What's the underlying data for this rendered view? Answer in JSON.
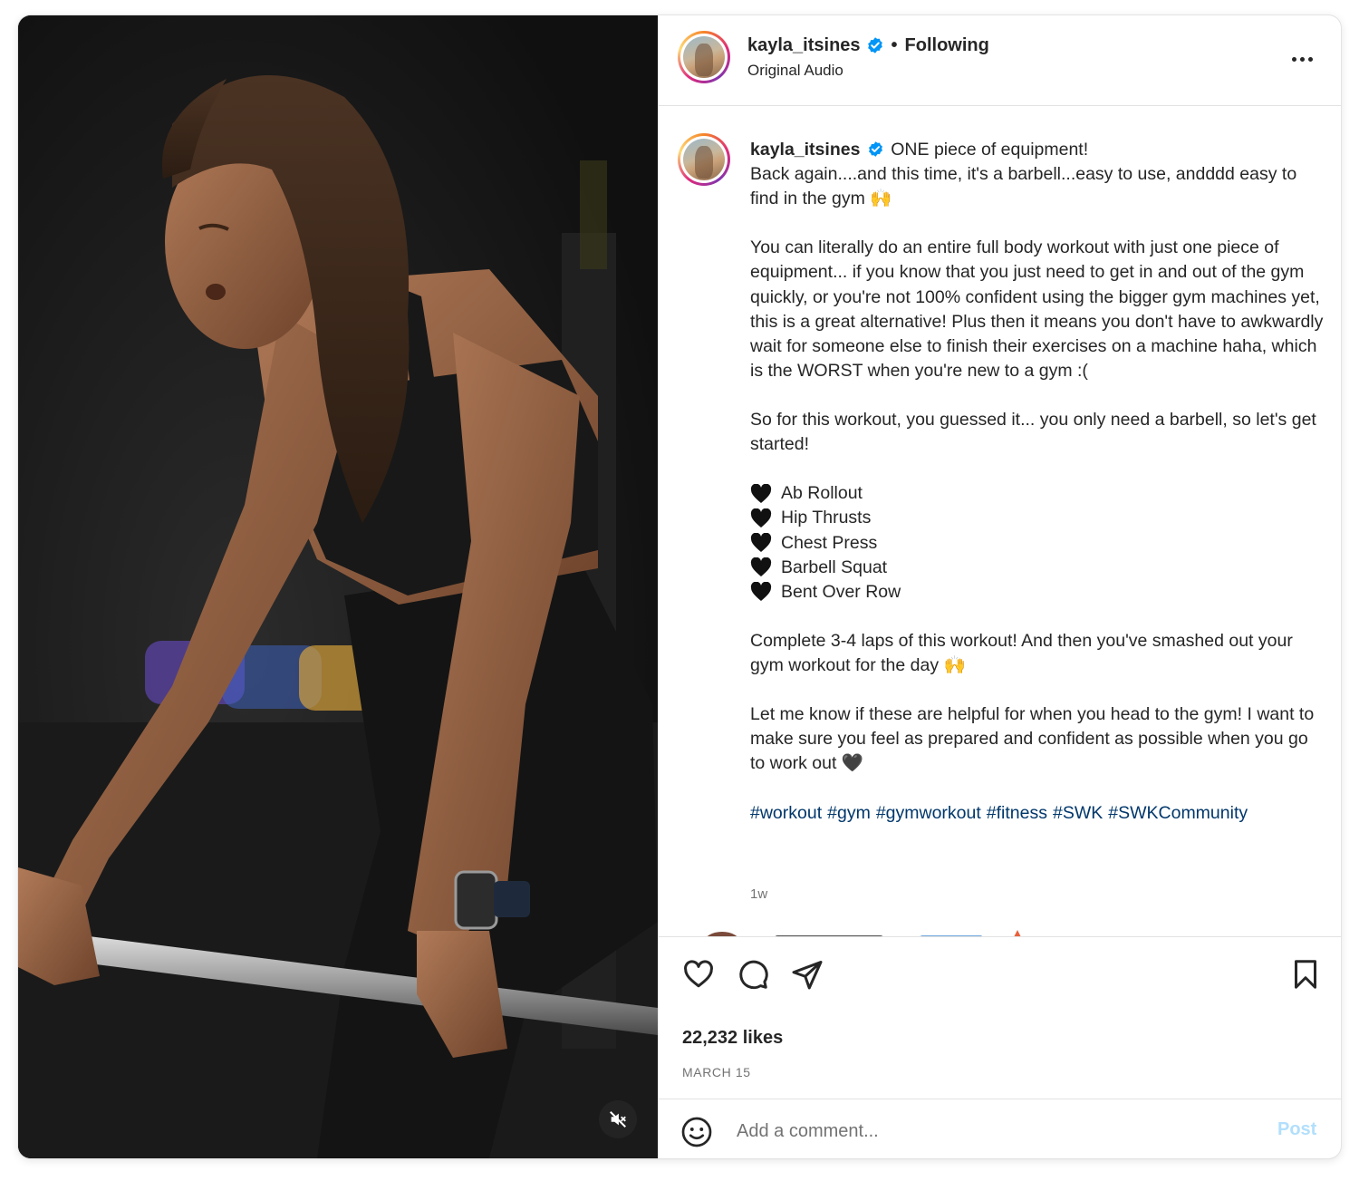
{
  "header": {
    "username": "kayla_itsines",
    "separator": "•",
    "follow_status": "Following",
    "audio": "Original Audio"
  },
  "caption": {
    "username": "kayla_itsines",
    "first_line": "ONE piece of equipment!",
    "line2": "Back again....and this time, it's a barbell...easy to use, andddd easy to find in the gym 🙌",
    "para2": "You can literally do an entire full body workout with just one piece of equipment... if you know that you just need to get in and out of the gym quickly, or you're not 100% confident using the bigger gym machines yet, this is a great alternative! Plus then it means you don't have to awkwardly wait for someone else to finish their exercises on a machine haha, which is the WORST when you're new to a gym :(",
    "para3": "So for this workout, you guessed it... you only need a barbell, so let's get started!",
    "exercises": [
      "Ab Rollout",
      "Hip Thrusts",
      "Chest Press",
      "Barbell Squat",
      "Bent Over Row"
    ],
    "para5": "Complete 3-4 laps of this workout! And then you've smashed out your gym workout for the day 🙌",
    "para6": "Let me know if these are helpful for when you head to the gym! I want to make sure you feel as prepared and confident as possible when you go to work out 🖤",
    "hashtags": [
      "#workout",
      "#gym",
      "#gymworkout",
      "#fitness",
      "#SWK",
      "#SWKCommunity"
    ],
    "time_ago": "1w"
  },
  "actions": {
    "likes": "22,232 likes",
    "date": "MARCH 15"
  },
  "comment": {
    "placeholder": "Add a comment...",
    "post_label": "Post"
  },
  "icons": {
    "verified": "verified-badge-icon",
    "like": "heart-icon",
    "comment": "comment-icon",
    "share": "share-icon",
    "save": "bookmark-icon",
    "emoji": "emoji-icon",
    "mute": "speaker-muted-icon",
    "more": "more-horizontal-icon"
  },
  "colors": {
    "verified": "#0095f6",
    "hashtag": "#00376b",
    "post_disabled": "#b2dffc",
    "muted_text": "#737373"
  }
}
